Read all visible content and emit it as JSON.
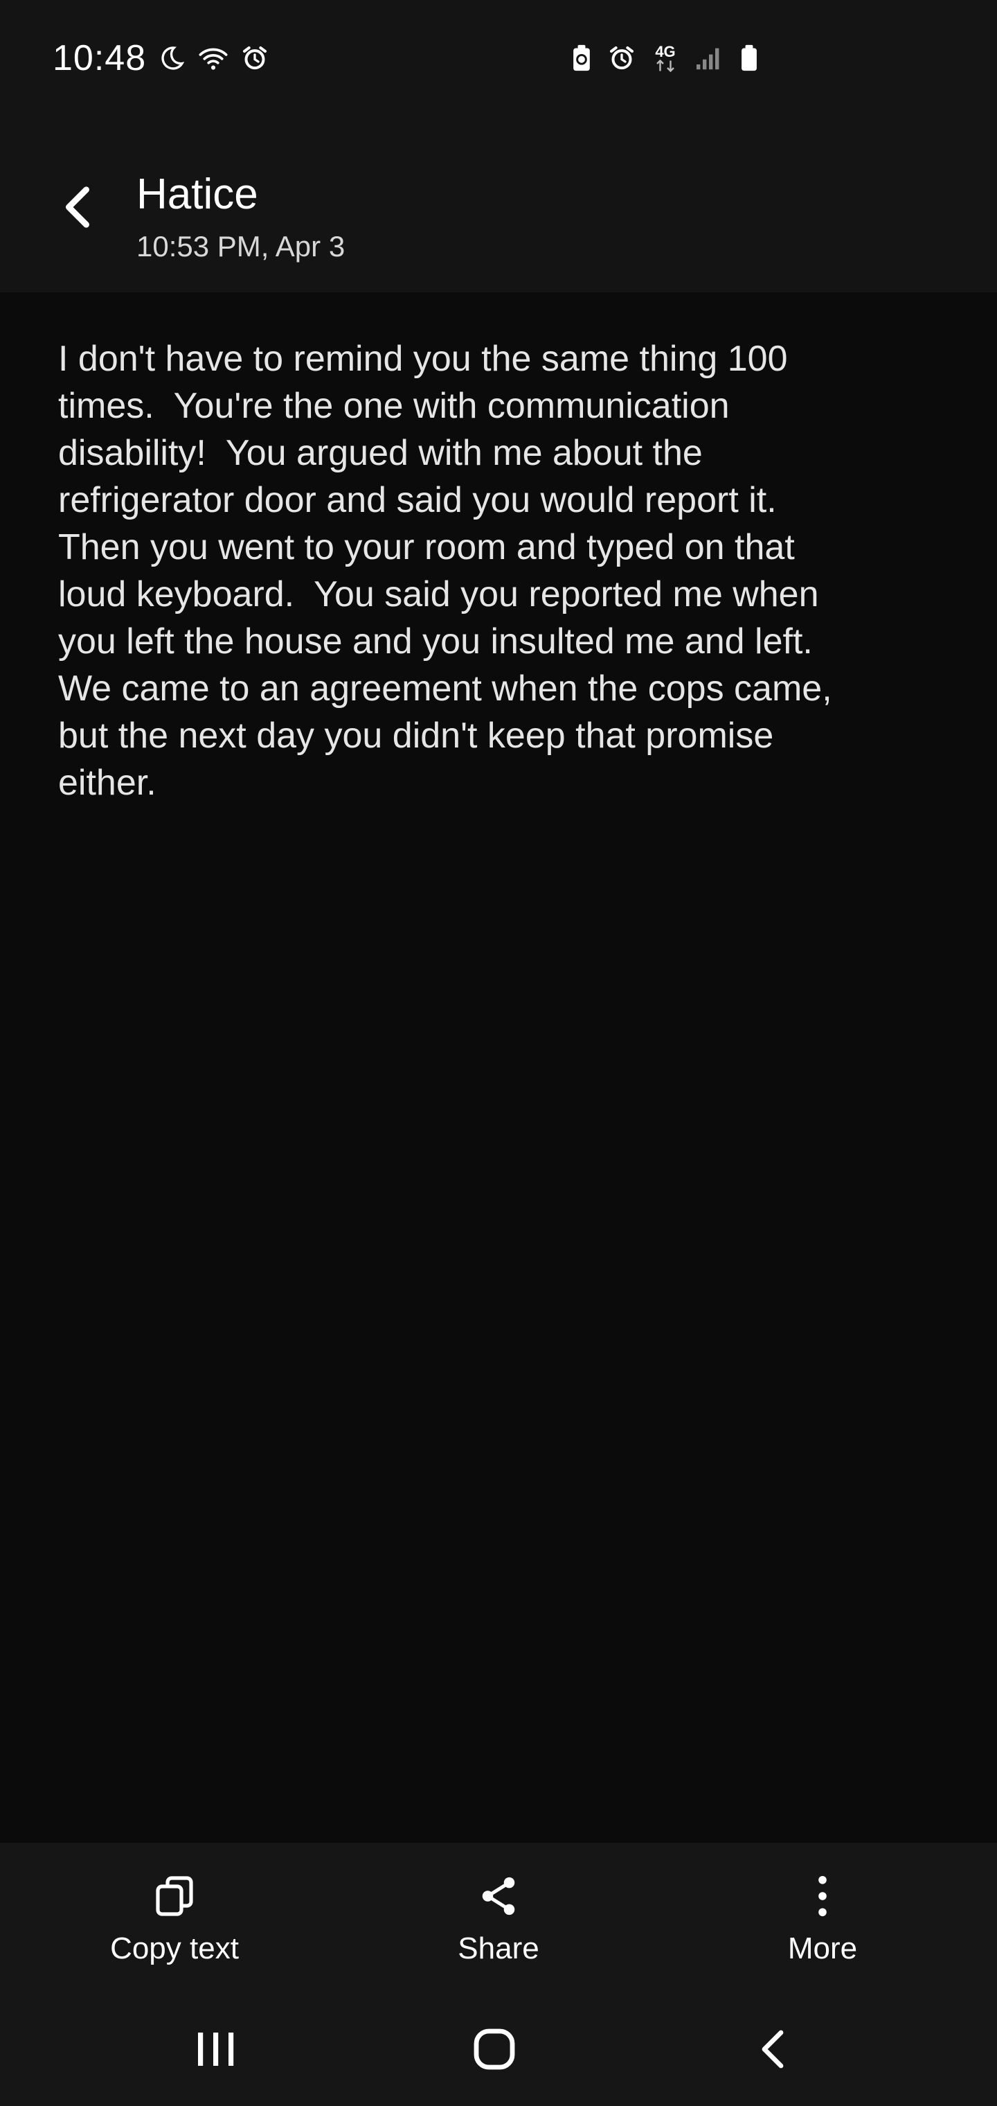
{
  "status_bar": {
    "time": "10:48",
    "left_icons": [
      "moon-icon",
      "wifi-icon",
      "alarm-icon"
    ],
    "right_icons": [
      "battery-saver-icon",
      "alarm-icon",
      "4g-lte-icon",
      "signal-icon",
      "battery-icon"
    ],
    "network_label": "4G"
  },
  "header": {
    "back_icon": "chevron-left-icon",
    "sender": "Hatice",
    "timestamp": "10:53 PM, Apr 3"
  },
  "message": {
    "body": "I don't have to remind you the same thing 100\ntimes.  You're the one with communication\ndisability!  You argued with me about the\nrefrigerator door and said you would report it.\nThen you went to your room and typed on that\nloud keyboard.  You said you reported me when\nyou left the house and you insulted me and left.\nWe came to an agreement when the cops came,\nbut the next day you didn't keep that promise\neither."
  },
  "actions": [
    {
      "label": "Copy text",
      "icon": "copy-icon"
    },
    {
      "label": "Share",
      "icon": "share-icon"
    },
    {
      "label": "More",
      "icon": "more-vertical-icon"
    }
  ],
  "nav_bar": {
    "recents_icon": "recents-icon",
    "home_icon": "home-icon",
    "back_icon": "nav-back-icon"
  },
  "colors": {
    "background": "#0b0b0b",
    "bars": "#141414",
    "text": "#e6e6e6",
    "secondary_text": "#d8d8d8"
  }
}
